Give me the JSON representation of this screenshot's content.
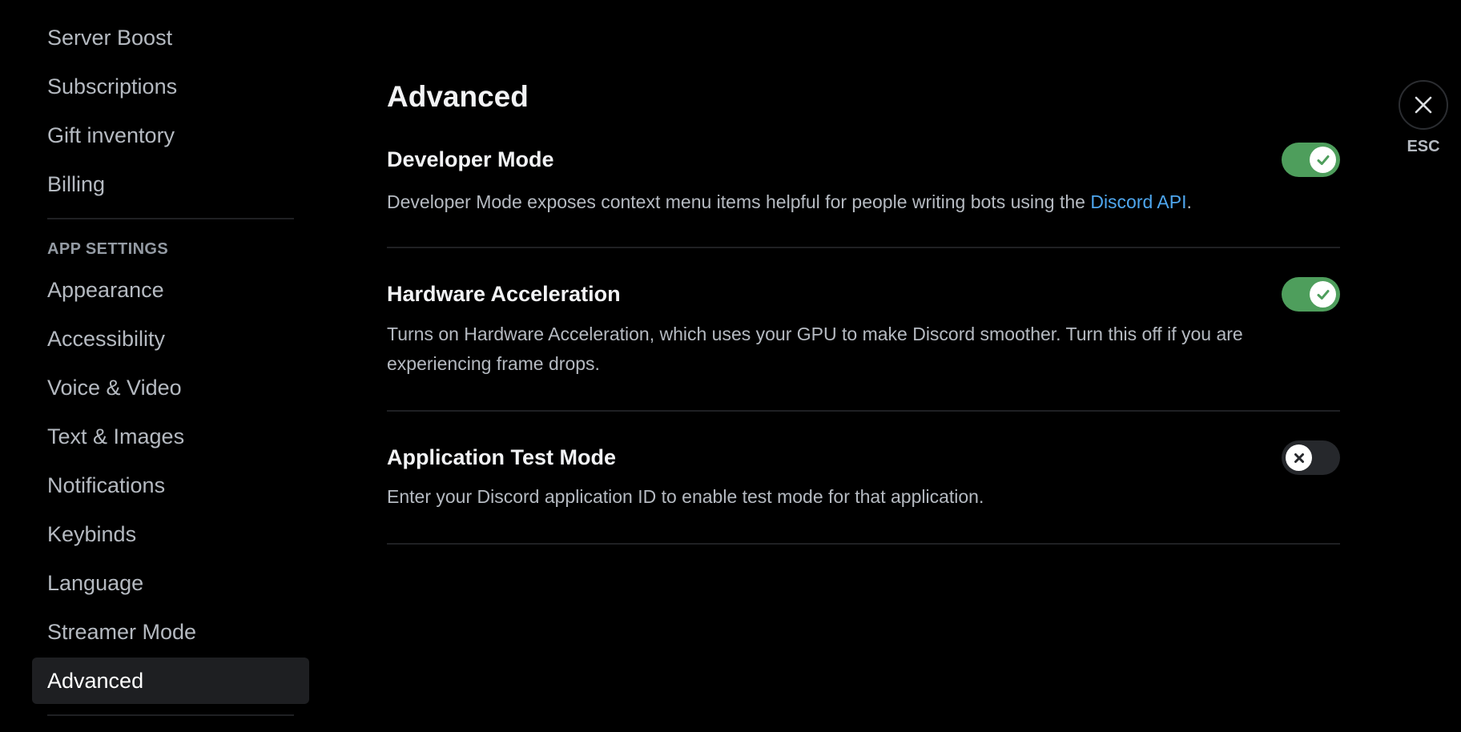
{
  "sidebar": {
    "items_top": [
      {
        "label": "Server Boost"
      },
      {
        "label": "Subscriptions"
      },
      {
        "label": "Gift inventory"
      },
      {
        "label": "Billing"
      }
    ],
    "section_header": "APP SETTINGS",
    "items_app": [
      {
        "label": "Appearance"
      },
      {
        "label": "Accessibility"
      },
      {
        "label": "Voice & Video"
      },
      {
        "label": "Text & Images"
      },
      {
        "label": "Notifications"
      },
      {
        "label": "Keybinds"
      },
      {
        "label": "Language"
      },
      {
        "label": "Streamer Mode"
      },
      {
        "label": "Advanced",
        "selected": true
      }
    ]
  },
  "main": {
    "title": "Advanced",
    "settings": [
      {
        "title": "Developer Mode",
        "description": "Developer Mode exposes context menu items helpful for people writing bots using the ",
        "link_text": "Discord API",
        "description_suffix": ".",
        "enabled": true
      },
      {
        "title": "Hardware Acceleration",
        "description": "Turns on Hardware Acceleration, which uses your GPU to make Discord smoother. Turn this off if you are experiencing frame drops.",
        "enabled": true
      },
      {
        "title": "Application Test Mode",
        "description": "Enter your Discord application ID to enable test mode for that application.",
        "enabled": false
      }
    ]
  },
  "close": {
    "label": "ESC",
    "icon": "close-icon"
  },
  "colors": {
    "background": "#000000",
    "selected_item": "#1e1f22",
    "toggle_on": "#4e9e5c",
    "toggle_off": "#26282c",
    "link": "#4ea6ee"
  }
}
